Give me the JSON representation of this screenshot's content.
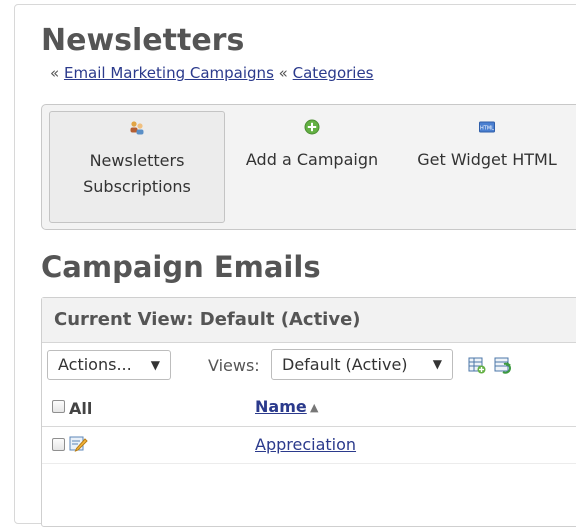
{
  "page": {
    "title": "Newsletters",
    "breadcrumb": {
      "prefix": "«",
      "link1": "Email Marketing Campaigns",
      "separator": "«",
      "link2": "Categories"
    }
  },
  "toolbar": {
    "items": [
      {
        "label_line1": "Newsletters",
        "label_line2": "Subscriptions",
        "icon": "users-icon"
      },
      {
        "label": "Add a Campaign",
        "icon": "add-circle-icon"
      },
      {
        "label": "Get Widget HTML",
        "icon": "html-icon",
        "icon_text": "HTML"
      }
    ]
  },
  "section": {
    "title": "Campaign Emails",
    "current_view": "Current View: Default (Active)",
    "actions_label": "Actions...",
    "views_label": "Views:",
    "views_selected": "Default (Active)",
    "table": {
      "headers": {
        "all": "All",
        "name": "Name"
      },
      "rows": [
        {
          "name": "Appreciation",
          "icon": "edit-icon"
        }
      ]
    }
  },
  "colors": {
    "link": "#2b3a8c",
    "heading": "#555555",
    "toolbar_bg": "#f3f3f3",
    "add_icon_green": "#63b043"
  }
}
